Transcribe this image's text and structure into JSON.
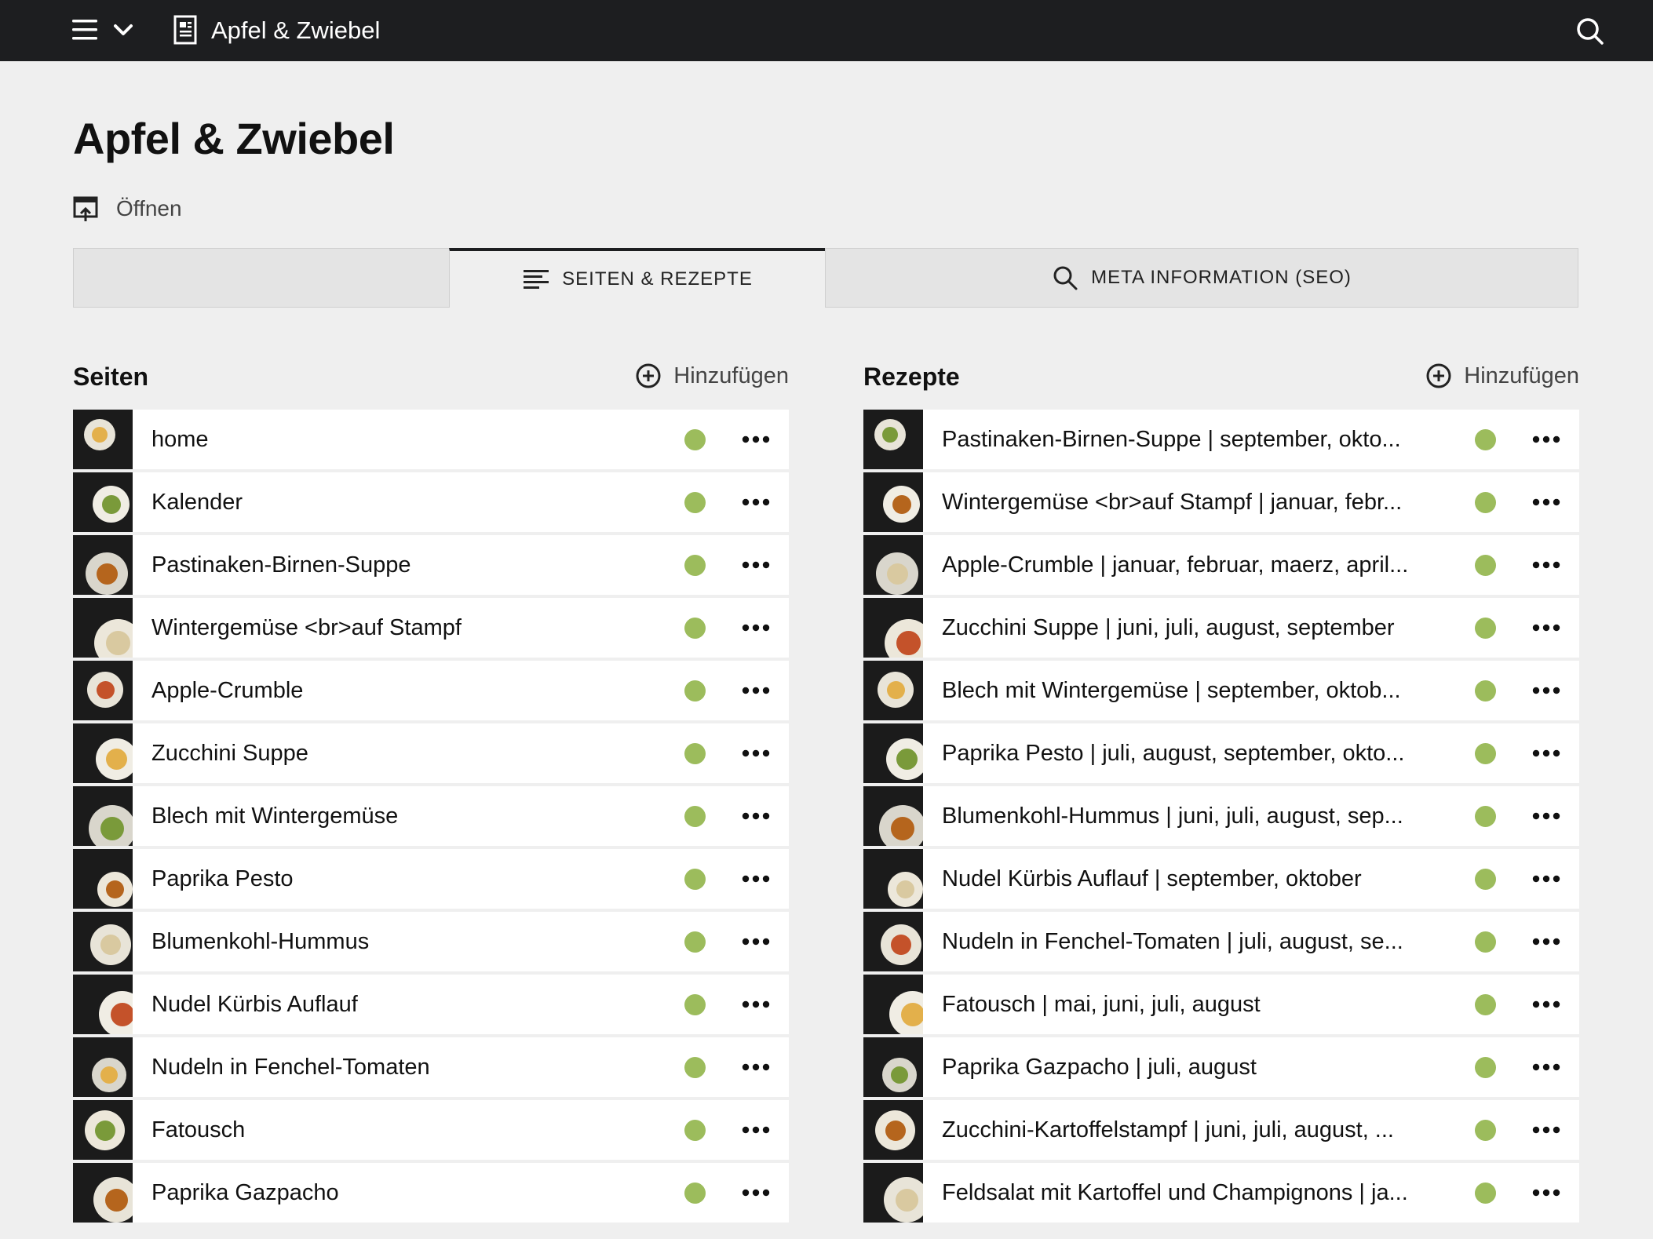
{
  "app": {
    "title": "Apfel & Zwiebel"
  },
  "page": {
    "title": "Apfel & Zwiebel",
    "open_label": "Öffnen"
  },
  "tabs": [
    {
      "label": ""
    },
    {
      "label": "SEITEN & REZEPTE",
      "icon": "list-icon",
      "active": true
    },
    {
      "label": "META INFORMATION (SEO)",
      "icon": "search-icon"
    }
  ],
  "colors": {
    "topbar": "#1d1e20",
    "status_published": "#9cbc5c",
    "background": "#efefef"
  },
  "seiten": {
    "title": "Seiten",
    "add_label": "Hinzufügen",
    "items": [
      {
        "label": "home"
      },
      {
        "label": "Kalender"
      },
      {
        "label": "Pastinaken-Birnen-Suppe"
      },
      {
        "label": "Wintergemüse <br>auf Stampf"
      },
      {
        "label": "Apple-Crumble"
      },
      {
        "label": "Zucchini Suppe"
      },
      {
        "label": "Blech mit Wintergemüse"
      },
      {
        "label": "Paprika Pesto"
      },
      {
        "label": "Blumenkohl-Hummus"
      },
      {
        "label": "Nudel Kürbis Auflauf"
      },
      {
        "label": "Nudeln in Fenchel-Tomaten"
      },
      {
        "label": "Fatousch"
      },
      {
        "label": "Paprika Gazpacho"
      }
    ]
  },
  "rezepte": {
    "title": "Rezepte",
    "add_label": "Hinzufügen",
    "items": [
      {
        "label": "Pastinaken-Birnen-Suppe | september, okto..."
      },
      {
        "label": "Wintergemüse <br>auf Stampf | januar, febr..."
      },
      {
        "label": "Apple-Crumble | januar, februar, maerz, april..."
      },
      {
        "label": "Zucchini Suppe | juni, juli, august, september"
      },
      {
        "label": "Blech mit Wintergemüse | september, oktob..."
      },
      {
        "label": "Paprika Pesto | juli, august, september, okto..."
      },
      {
        "label": "Blumenkohl-Hummus | juni, juli, august, sep..."
      },
      {
        "label": "Nudel Kürbis Auflauf | september, oktober"
      },
      {
        "label": "Nudeln in Fenchel-Tomaten | juli, august, se..."
      },
      {
        "label": "Fatousch | mai, juni, juli, august"
      },
      {
        "label": "Paprika Gazpacho | juli, august"
      },
      {
        "label": "Zucchini-Kartoffelstampf | juni, juli, august, ..."
      },
      {
        "label": "Feldsalat mit Kartoffel und Champignons | ja..."
      }
    ]
  }
}
